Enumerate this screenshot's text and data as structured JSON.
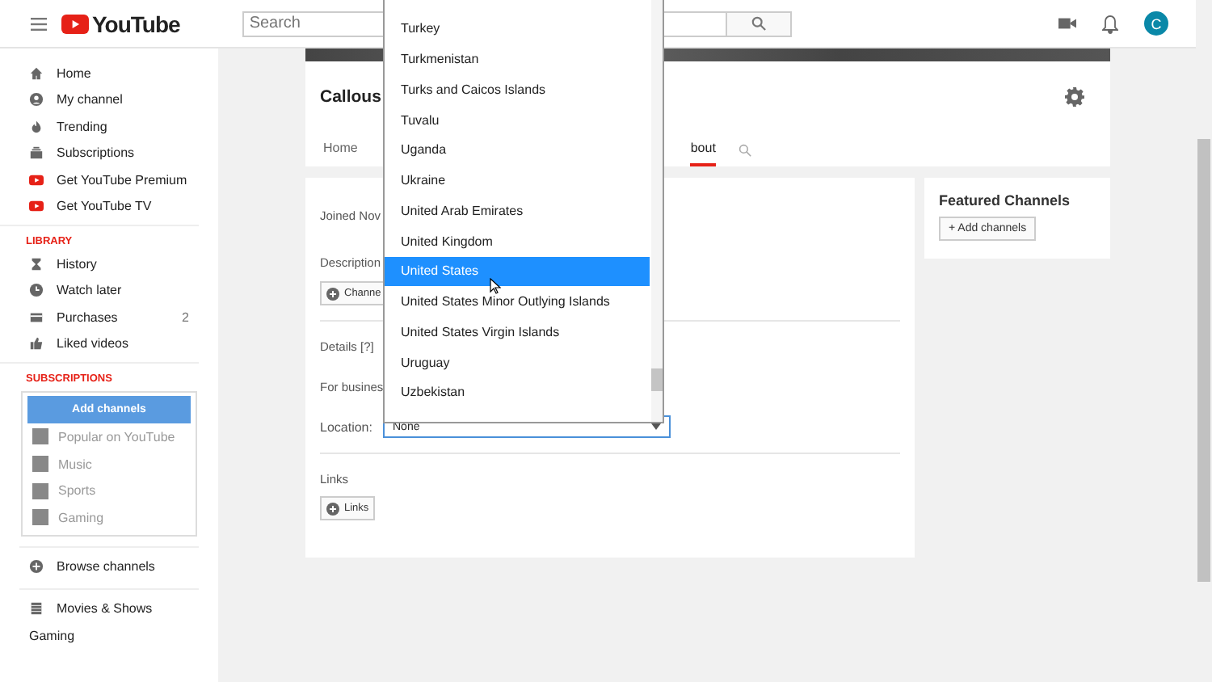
{
  "header": {
    "logo_text": "YouTube",
    "search": {
      "placeholder": "Search"
    },
    "avatar": "C"
  },
  "sidebar": {
    "main": [
      {
        "label": "Home"
      },
      {
        "label": "My channel"
      },
      {
        "label": "Trending"
      },
      {
        "label": "Subscriptions"
      },
      {
        "label": "Get YouTube Premium"
      },
      {
        "label": "Get YouTube TV"
      }
    ],
    "library_heading": "LIBRARY",
    "library": [
      {
        "label": "History"
      },
      {
        "label": "Watch later"
      },
      {
        "label": "Purchases",
        "count": "2"
      },
      {
        "label": "Liked videos"
      }
    ],
    "subscriptions_heading": "SUBSCRIPTIONS",
    "add_channels_button": "Add channels",
    "suggestions": [
      {
        "label": "Popular on YouTube"
      },
      {
        "label": "Music"
      },
      {
        "label": "Sports"
      },
      {
        "label": "Gaming"
      }
    ],
    "browse": "Browse channels",
    "bottom": [
      {
        "label": "Movies & Shows",
        "kind": "icon"
      },
      {
        "label": "Gaming",
        "kind": "plain"
      }
    ]
  },
  "channel": {
    "title": "Callous",
    "tabs": [
      {
        "label": "Home",
        "selected": false
      },
      {
        "label": "bout",
        "selected": true
      }
    ]
  },
  "about": {
    "joined": "Joined Nov",
    "description_label": "Description",
    "channel_button": "Channe",
    "details_label": "Details [?]",
    "business_label": "For busines",
    "location_label": "Location:",
    "location_value": "None",
    "links_label": "Links",
    "links_button": "Links"
  },
  "featured": {
    "title": "Featured Channels",
    "button": "+ Add channels"
  },
  "dropdown": {
    "options": [
      {
        "label": "Turkey",
        "selected": false
      },
      {
        "label": "Turkmenistan",
        "selected": false
      },
      {
        "label": "Turks and Caicos Islands",
        "selected": false
      },
      {
        "label": "Tuvalu",
        "selected": false
      },
      {
        "label": "Uganda",
        "selected": false
      },
      {
        "label": "Ukraine",
        "selected": false
      },
      {
        "label": "United Arab Emirates",
        "selected": false
      },
      {
        "label": "United Kingdom",
        "selected": false
      },
      {
        "label": "United States",
        "selected": true
      },
      {
        "label": "United States Minor Outlying Islands",
        "selected": false
      },
      {
        "label": "United States Virgin Islands",
        "selected": false
      },
      {
        "label": "Uruguay",
        "selected": false
      },
      {
        "label": "Uzbekistan",
        "selected": false
      }
    ]
  }
}
